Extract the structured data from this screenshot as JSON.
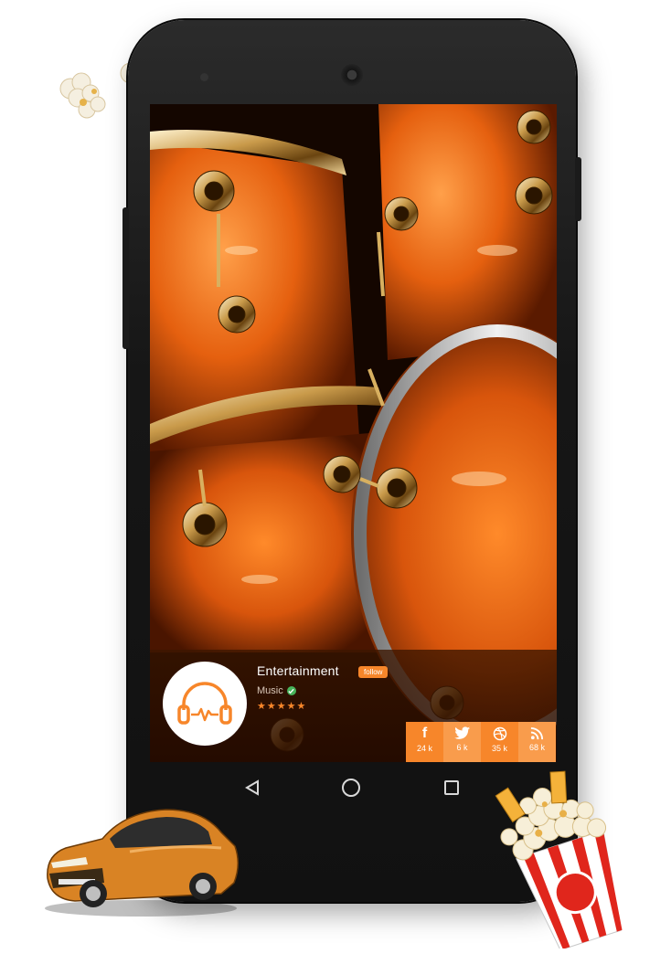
{
  "profile": {
    "title": "Entertainment",
    "follow_label": "follow",
    "subtitle": "Music",
    "verified": true,
    "rating": 5,
    "stars_text": "★★★★★",
    "avatar_icon": "headphones-heartbeat-icon"
  },
  "social": [
    {
      "icon": "facebook-icon",
      "count": "24 k",
      "glyph": "f"
    },
    {
      "icon": "twitter-icon",
      "count": "6 k"
    },
    {
      "icon": "dribbble-icon",
      "count": "35 k"
    },
    {
      "icon": "rss-icon",
      "count": "68 k"
    }
  ],
  "navigation": {
    "back_icon": "back-triangle-icon",
    "home_icon": "home-circle-icon",
    "recents_icon": "recents-square-icon"
  },
  "colors": {
    "accent": "#f7862a",
    "accent_light": "#f99c4c",
    "verified": "#47b35a",
    "phone_body": "#161616"
  }
}
